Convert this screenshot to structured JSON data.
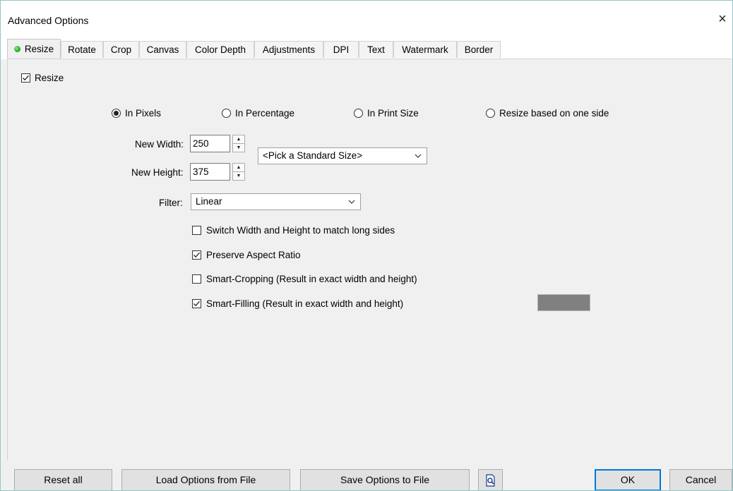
{
  "window": {
    "title": "Advanced Options",
    "close_icon": "×"
  },
  "tabs": [
    {
      "label": "Resize"
    },
    {
      "label": "Rotate"
    },
    {
      "label": "Crop"
    },
    {
      "label": "Canvas"
    },
    {
      "label": "Color Depth"
    },
    {
      "label": "Adjustments"
    },
    {
      "label": "DPI"
    },
    {
      "label": "Text"
    },
    {
      "label": "Watermark"
    },
    {
      "label": "Border"
    }
  ],
  "resize": {
    "enable_label": "Resize",
    "enable_checked": true,
    "modes": [
      {
        "label": "In Pixels",
        "selected": true
      },
      {
        "label": "In Percentage",
        "selected": false
      },
      {
        "label": "In Print Size",
        "selected": false
      },
      {
        "label": "Resize based on one side",
        "selected": false
      }
    ],
    "width_label": "New Width:",
    "width_value": "250",
    "height_label": "New Height:",
    "height_value": "375",
    "standard_size": "<Pick a Standard Size>",
    "filter_label": "Filter:",
    "filter_value": "Linear",
    "options": [
      {
        "label": "Switch Width and Height to match long sides",
        "checked": false
      },
      {
        "label": "Preserve Aspect Ratio",
        "checked": true
      },
      {
        "label": "Smart-Cropping (Result in exact width and height)",
        "checked": false
      },
      {
        "label": "Smart-Filling (Result in exact width and height)",
        "checked": true
      }
    ],
    "fill_color": "#808080"
  },
  "footer": {
    "reset_label": "Reset all",
    "load_label": "Load Options from File",
    "save_label": "Save Options to File",
    "ok_label": "OK",
    "cancel_label": "Cancel"
  },
  "colors": {
    "accent": "#0078d7",
    "active_tab_dot": "#16a31a"
  }
}
